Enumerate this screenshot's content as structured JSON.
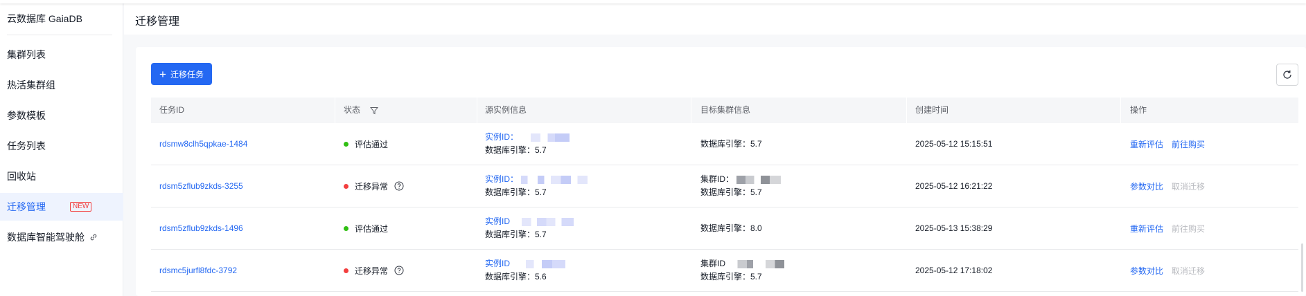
{
  "sidebar": {
    "title": "云数据库 GaiaDB",
    "items": [
      {
        "label": "集群列表"
      },
      {
        "label": "热活集群组"
      },
      {
        "label": "参数模板"
      },
      {
        "label": "任务列表"
      },
      {
        "label": "回收站"
      },
      {
        "label": "迁移管理",
        "badge": "NEW",
        "active": true
      },
      {
        "label": "数据库智能驾驶舱",
        "icon": "link-icon"
      }
    ]
  },
  "header": {
    "title": "迁移管理"
  },
  "toolbar": {
    "create_label": "迁移任务",
    "create_icon": "plus-icon",
    "refresh_icon": "refresh-icon"
  },
  "table": {
    "columns": [
      "任务ID",
      "状态",
      "源实例信息",
      "目标集群信息",
      "创建时间",
      "操作"
    ],
    "rows": [
      {
        "task_id": "rdsmw8clh5qpkae-1484",
        "status": "评估通过",
        "status_color": "#30bf13",
        "status_help": false,
        "source_label": "实例ID：",
        "source_engine": "数据库引擎：5.7",
        "target_label": "",
        "target_engine": "数据库引擎：5.7",
        "created": "2025-05-12 15:15:51",
        "actions": [
          {
            "label": "重新评估",
            "enabled": true
          },
          {
            "label": "前往购买",
            "enabled": true
          }
        ]
      },
      {
        "task_id": "rdsm5zflub9zkds-3255",
        "status": "迁移异常",
        "status_color": "#f33e3e",
        "status_help": true,
        "source_label": "实例ID：",
        "source_engine": "数据库引擎：5.7",
        "target_label": "集群ID：",
        "target_engine": "数据库引擎：5.7",
        "created": "2025-05-12 16:21:22",
        "actions": [
          {
            "label": "参数对比",
            "enabled": true
          },
          {
            "label": "取消迁移",
            "enabled": false
          }
        ]
      },
      {
        "task_id": "rdsm5zflub9zkds-1496",
        "status": "评估通过",
        "status_color": "#30bf13",
        "status_help": false,
        "source_label": "实例ID",
        "source_engine": "数据库引擎：5.7",
        "target_label": "",
        "target_engine": "数据库引擎：8.0",
        "created": "2025-05-13 15:38:29",
        "actions": [
          {
            "label": "重新评估",
            "enabled": true
          },
          {
            "label": "前往购买",
            "enabled": false
          }
        ]
      },
      {
        "task_id": "rdsmc5jurfl8fdc-3792",
        "status": "迁移异常",
        "status_color": "#f33e3e",
        "status_help": true,
        "source_label": "实例ID",
        "source_engine": "数据库引擎：5.6",
        "target_label": "集群ID",
        "target_engine": "数据库引擎：5.7",
        "created": "2025-05-12 17:18:02",
        "actions": [
          {
            "label": "参数对比",
            "enabled": true
          },
          {
            "label": "取消迁移",
            "enabled": false
          }
        ]
      }
    ]
  },
  "colors": {
    "primary": "#2468f2",
    "success": "#30bf13",
    "error": "#f33e3e",
    "disabled": "#b8babf"
  }
}
